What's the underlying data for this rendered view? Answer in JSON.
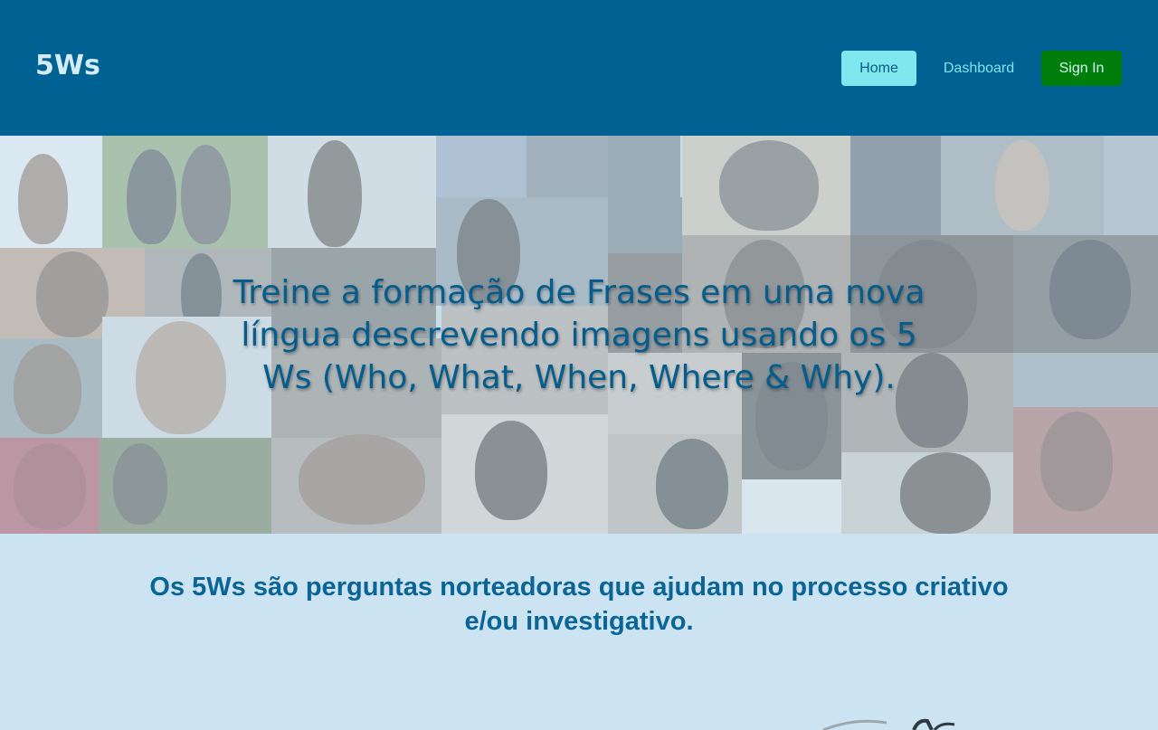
{
  "header": {
    "brand": "5Ws",
    "nav": {
      "home": "Home",
      "dashboard": "Dashboard",
      "sign_in": "Sign In"
    }
  },
  "hero": {
    "headline": "Treine a formação de Frases em uma nova língua descrevendo imagens usando os 5 Ws (Who, What, When, Where & Why)."
  },
  "info": {
    "text": "Os 5Ws são perguntas norteadoras que ajudam no processo criativo e/ou investigativo."
  },
  "colors": {
    "header_bg": "#006193",
    "home_button_bg": "#7fe7ee",
    "sign_in_button_bg": "#007e0c",
    "page_bg": "#cce4f1",
    "text_accent": "#0a6596"
  }
}
